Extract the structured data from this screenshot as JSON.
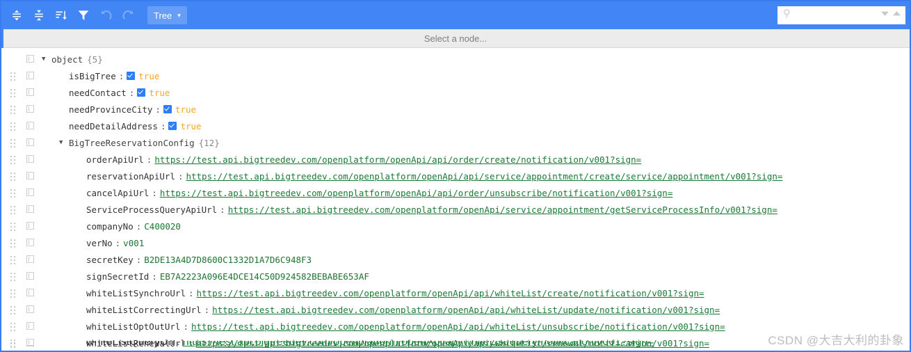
{
  "toolbar": {
    "buttons": [
      {
        "name": "expand-all-icon",
        "title": "Expand all"
      },
      {
        "name": "collapse-all-icon",
        "title": "Collapse all"
      },
      {
        "name": "sort-icon",
        "title": "Sort"
      },
      {
        "name": "filter-icon",
        "title": "Filter"
      },
      {
        "name": "undo-icon",
        "title": "Undo"
      },
      {
        "name": "redo-icon",
        "title": "Redo"
      }
    ],
    "mode_label": "Tree",
    "mode_caret": "▾",
    "background_color": "#4285f4",
    "mode_button_color": "#669df6"
  },
  "search": {
    "value": "",
    "placeholder": "",
    "icon": "search-icon",
    "next_icon": "▼",
    "prev_icon": "▲"
  },
  "node_bar": {
    "text": "Select a node..."
  },
  "tree": {
    "collapse_glyph": "▼",
    "rows": [
      {
        "indent": 0,
        "twisty": true,
        "drag": false,
        "key": "object",
        "count": "{5}",
        "kind": "node"
      },
      {
        "indent": 1,
        "twisty": false,
        "drag": true,
        "key": "isBigTree",
        "kind": "bool",
        "value": "true"
      },
      {
        "indent": 1,
        "twisty": false,
        "drag": true,
        "key": "needContact",
        "kind": "bool",
        "value": "true"
      },
      {
        "indent": 1,
        "twisty": false,
        "drag": true,
        "key": "needProvinceCity",
        "kind": "bool",
        "value": "true"
      },
      {
        "indent": 1,
        "twisty": false,
        "drag": true,
        "key": "needDetailAddress",
        "kind": "bool",
        "value": "true"
      },
      {
        "indent": 1,
        "twisty": true,
        "drag": true,
        "key": "BigTreeReservationConfig",
        "count": "{12}",
        "kind": "node"
      },
      {
        "indent": 2,
        "twisty": false,
        "drag": true,
        "key": "orderApiUrl",
        "kind": "link",
        "value": "https://test.api.bigtreedev.com/openplatform/openApi/api/order/create/notification/v001?sign="
      },
      {
        "indent": 2,
        "twisty": false,
        "drag": true,
        "key": "reservationApiUrl",
        "kind": "link",
        "value": "https://test.api.bigtreedev.com/openplatform/openApi/api/service/appointment/create/service/appointment/v001?sign="
      },
      {
        "indent": 2,
        "twisty": false,
        "drag": true,
        "key": "cancelApiUrl",
        "kind": "link",
        "value": "https://test.api.bigtreedev.com/openplatform/openApi/api/order/unsubscribe/notification/v001?sign="
      },
      {
        "indent": 2,
        "twisty": false,
        "drag": true,
        "key": "ServiceProcessQueryApiUrl",
        "kind": "link",
        "value": "https://test.api.bigtreedev.com/openplatform/openApi/service/appointment/getServiceProcessInfo/v001?sign="
      },
      {
        "indent": 2,
        "twisty": false,
        "drag": true,
        "key": "companyNo",
        "kind": "str",
        "value": "C400020"
      },
      {
        "indent": 2,
        "twisty": false,
        "drag": true,
        "key": "verNo",
        "kind": "str",
        "value": "v001"
      },
      {
        "indent": 2,
        "twisty": false,
        "drag": true,
        "key": "secretKey",
        "kind": "str",
        "value": "B2DE13A4D7D8600C1332D1A7D6C948F3"
      },
      {
        "indent": 2,
        "twisty": false,
        "drag": true,
        "key": "signSecretId",
        "kind": "str",
        "value": "EB7A2223A096E4DCE14C50D924582BEBABE653AF"
      },
      {
        "indent": 2,
        "twisty": false,
        "drag": true,
        "key": "whiteListSynchroUrl",
        "kind": "link",
        "value": "https://test.api.bigtreedev.com/openplatform/openApi/api/whiteList/create/notification/v001?sign="
      },
      {
        "indent": 2,
        "twisty": false,
        "drag": true,
        "key": "whiteListCorrectingUrl",
        "kind": "link",
        "value": "https://test.api.bigtreedev.com/openplatform/openApi/api/whiteList/update/notification/v001?sign="
      },
      {
        "indent": 2,
        "twisty": false,
        "drag": true,
        "key": "whiteListOptOutUrl",
        "kind": "link",
        "value": "https://test.api.bigtreedev.com/openplatform/openApi/api/whiteList/unsubscribe/notification/v001?sign="
      },
      {
        "indent": 2,
        "twisty": false,
        "drag": true,
        "key": "whiteListRenewalUrl",
        "kind": "link",
        "value": "https://test.api.bigtreedev.com/openplatform/openApi/api/whiteList/renewal/notification/v001?sign="
      }
    ],
    "clipped_row": {
      "indent": 2,
      "twisty": false,
      "drag": true,
      "key": "whiteListQueryUrl",
      "kind": "link",
      "value": "https://test.api.bigtreedev.com/openplatform/openApi/api/whiteList/query/notification/v001?sign="
    }
  },
  "watermark": {
    "text": "CSDN @大吉大利的卦象"
  },
  "colors": {
    "accent": "#4285f4",
    "bool_value": "#f5a623",
    "string_value": "#1c7430",
    "link_value": "#1a7a35",
    "checkbox": "#2d7ff9"
  }
}
